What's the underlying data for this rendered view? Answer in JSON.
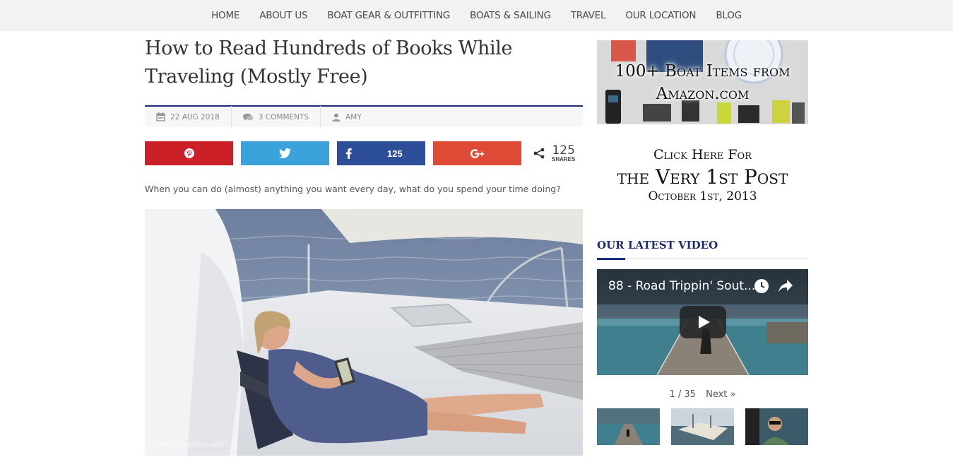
{
  "nav": {
    "items": [
      "HOME",
      "ABOUT US",
      "BOAT GEAR & OUTFITTING",
      "BOATS & SAILING",
      "TRAVEL",
      "OUR LOCATION",
      "BLOG"
    ]
  },
  "post": {
    "title": "How to Read Hundreds of Books While Traveling (Mostly Free)",
    "date": "22 AUG 2018",
    "comments": "3 COMMENTS",
    "author": "AMY",
    "intro": "When you can do (almost) anything you want every day, what do you spend your time doing?",
    "watermark": "OutChasingStars.com"
  },
  "share": {
    "facebook_count": "125",
    "total": "125",
    "total_label": "SHARES"
  },
  "sidebar": {
    "amazon_line1": "100+ Boat Items from",
    "amazon_line2": "Amazon.com",
    "first_post_line1": "Click Here For",
    "first_post_line2": "the Very 1st Post",
    "first_post_line3": "October 1st, 2013",
    "video_heading": "OUR LATEST VIDEO",
    "video_title": "88 - Road Trippin' Sout...",
    "pager_position": "1 / 35",
    "pager_next": "Next »"
  },
  "colors": {
    "pinterest": "#cb2027",
    "twitter": "#3ca2db",
    "facebook": "#2d4e99",
    "google_plus": "#de4a35",
    "accent_navy": "#1c2c7a"
  }
}
